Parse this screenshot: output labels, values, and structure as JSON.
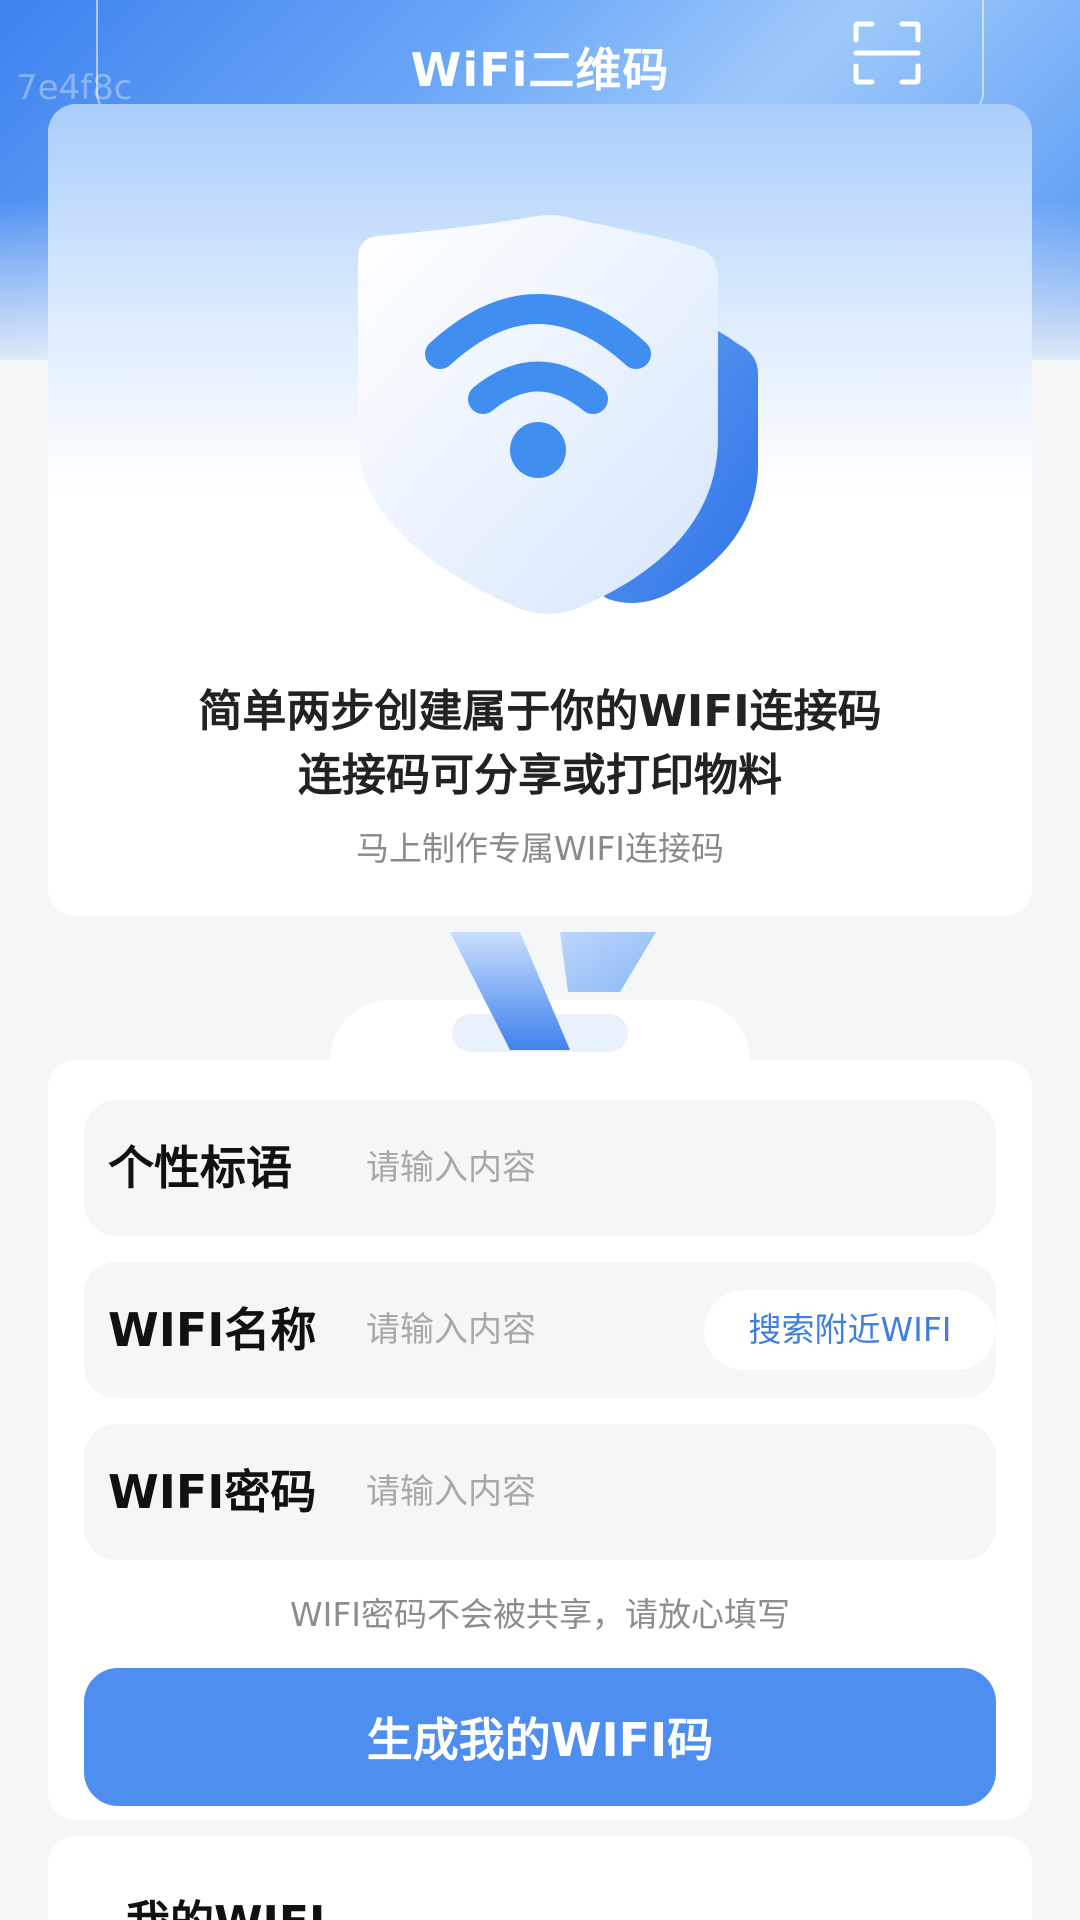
{
  "header": {
    "title": "WiFi二维码",
    "watermark": "7e4f8c",
    "scan_icon": "scan-icon"
  },
  "hero": {
    "headline_line1": "简单两步创建属于你的WIFI连接码",
    "headline_line2": "连接码可分享或打印物料",
    "subline": "马上制作专属WIFI连接码",
    "illustration_icon": "wifi-shield-icon"
  },
  "form": {
    "rows": [
      {
        "label": "个性标语",
        "placeholder": "请输入内容"
      },
      {
        "label": "WIFI名称",
        "placeholder": "请输入内容",
        "action": "搜索附近WIFI"
      },
      {
        "label": "WIFI密码",
        "placeholder": "请输入内容"
      }
    ],
    "hint": "WIFI密码不会被共享，请放心填写",
    "submit_label": "生成我的WIFI码"
  },
  "my_wifi": {
    "title": "我的WIFI"
  },
  "colors": {
    "accent": "#4d8ef0",
    "link": "#3f7fe0",
    "background": "#f5f6f8"
  }
}
